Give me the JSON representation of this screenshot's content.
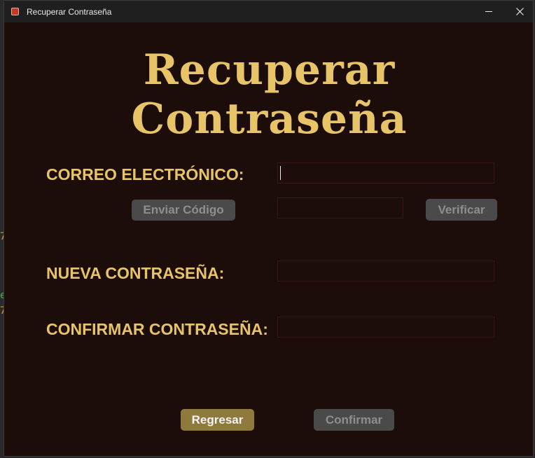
{
  "window": {
    "title": "Recuperar Contraseña"
  },
  "colors": {
    "background": "#1c0c0a",
    "accent": "#e8c468",
    "button_disabled": "#4a4a4a",
    "button_primary": "#8e7a3c"
  },
  "icons": {
    "app": "app-icon",
    "minimize": "minimize-icon",
    "close": "close-icon"
  },
  "main": {
    "heading": "Recuperar Contraseña",
    "email_label": "CORREO ELECTRÓNICO:",
    "email_value": "",
    "send_code_label": "Enviar Código",
    "code_value": "",
    "verify_label": "Verificar",
    "new_password_label": "NUEVA CONTRASEÑA:",
    "new_password_value": "",
    "confirm_password_label": "CONFIRMAR CONTRASEÑA:",
    "confirm_password_value": "",
    "back_label": "Regresar",
    "confirm_label": "Confirmar"
  }
}
